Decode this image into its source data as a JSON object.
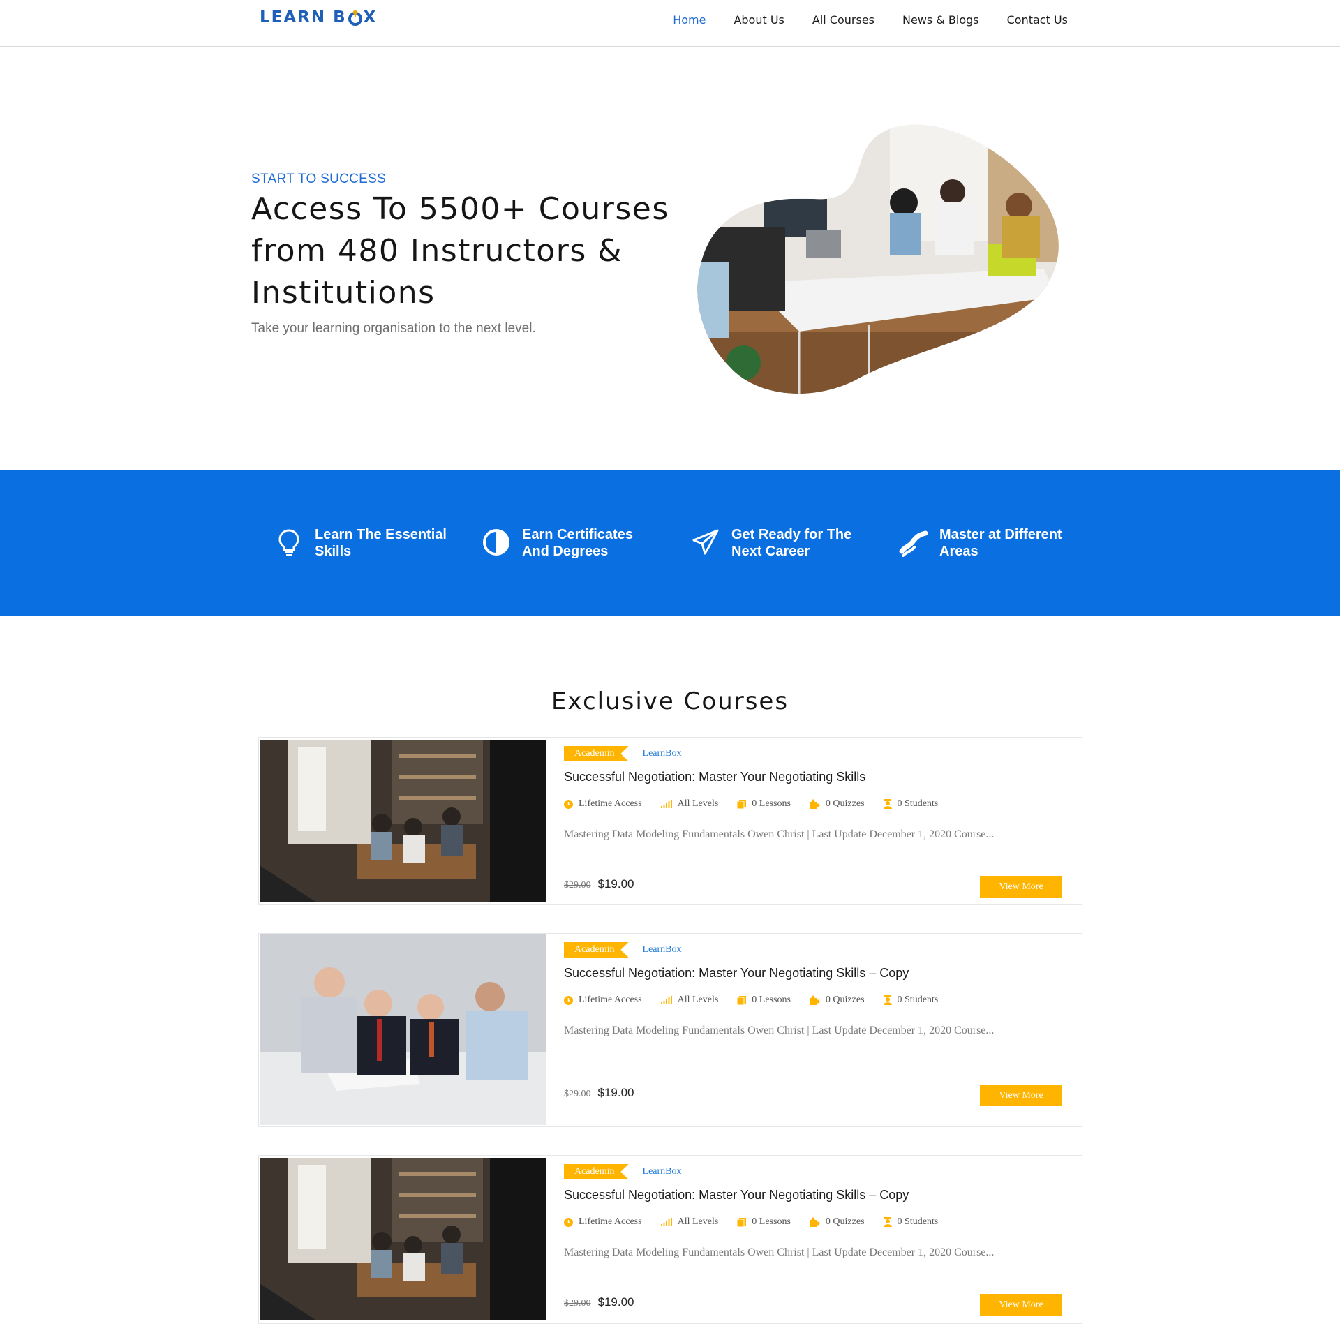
{
  "header": {
    "logo_text_left": "LEARN B",
    "logo_text_right": "X",
    "nav": [
      {
        "label": "Home",
        "active": true
      },
      {
        "label": "About Us",
        "active": false
      },
      {
        "label": "All Courses",
        "active": false
      },
      {
        "label": "News & Blogs",
        "active": false
      },
      {
        "label": "Contact Us",
        "active": false
      }
    ]
  },
  "hero": {
    "kicker": "START TO SUCCESS",
    "title": "Access To 5500+ Courses from 480 Instructors & Institutions",
    "subtitle": "Take your learning organisation to the next level."
  },
  "features": [
    {
      "icon": "lightbulb-icon",
      "label": "Learn The Essential Skills"
    },
    {
      "icon": "half-circle-icon",
      "label": "Earn Certificates And Degrees"
    },
    {
      "icon": "paper-plane-icon",
      "label": "Get Ready for The Next Career"
    },
    {
      "icon": "ribbon-icon",
      "label": "Master at Different Areas"
    }
  ],
  "courses_section": {
    "title": "Exclusive Courses"
  },
  "courses": [
    {
      "category": "Academin",
      "author": "LearnBox",
      "title": "Successful Negotiation: Master Your Negotiating Skills",
      "meta": {
        "access": "Lifetime Access",
        "level": "All Levels",
        "lessons": "0 Lessons",
        "quizzes": "0 Quizzes",
        "students": "0 Students"
      },
      "description": "Mastering Data Modeling Fundamentals   Owen Christ | Last Update December 1, 2020 Course...",
      "old_price": "$29.00",
      "price": "$19.00",
      "button": "View More",
      "image": "team-cafe-meeting-photo"
    },
    {
      "category": "Academin",
      "author": "LearnBox",
      "title": "Successful Negotiation: Master Your Negotiating Skills – Copy",
      "meta": {
        "access": "Lifetime Access",
        "level": "All Levels",
        "lessons": "0 Lessons",
        "quizzes": "0 Quizzes",
        "students": "0 Students"
      },
      "description": "Mastering Data Modeling Fundamentals   Owen Christ | Last Update December 1, 2020 Course...",
      "old_price": "$29.00",
      "price": "$19.00",
      "button": "View More",
      "image": "business-men-table-photo"
    },
    {
      "category": "Academin",
      "author": "LearnBox",
      "title": "Successful Negotiation: Master Your Negotiating Skills – Copy",
      "meta": {
        "access": "Lifetime Access",
        "level": "All Levels",
        "lessons": "0 Lessons",
        "quizzes": "0 Quizzes",
        "students": "0 Students"
      },
      "description": "Mastering Data Modeling Fundamentals   Owen Christ | Last Update December 1, 2020 Course...",
      "old_price": "$29.00",
      "price": "$19.00",
      "button": "View More",
      "image": "team-cafe-meeting-photo"
    }
  ],
  "colors": {
    "brand_blue": "#1e6bd6",
    "band_blue": "#0a6fe0",
    "accent_yellow": "#ffb400"
  }
}
